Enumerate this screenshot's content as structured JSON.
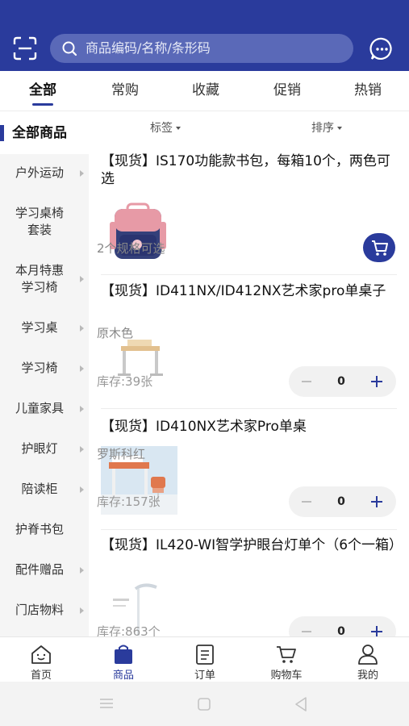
{
  "header": {
    "search_placeholder": "商品编码/名称/条形码",
    "accent_color": "#2a3b9c"
  },
  "tabs": [
    {
      "label": "全部",
      "active": true
    },
    {
      "label": "常购",
      "active": false
    },
    {
      "label": "收藏",
      "active": false
    },
    {
      "label": "促销",
      "active": false
    },
    {
      "label": "热销",
      "active": false
    }
  ],
  "sidebar": {
    "heading": "全部商品",
    "items": [
      {
        "label": "户外运动",
        "has_arrow": true
      },
      {
        "label": "学习桌椅\n套装",
        "has_arrow": false
      },
      {
        "label": "本月特惠\n学习椅",
        "has_arrow": true
      },
      {
        "label": "学习桌",
        "has_arrow": true
      },
      {
        "label": "学习椅",
        "has_arrow": true
      },
      {
        "label": "儿童家具",
        "has_arrow": true
      },
      {
        "label": "护眼灯",
        "has_arrow": true
      },
      {
        "label": "陪读柜",
        "has_arrow": true
      },
      {
        "label": "护脊书包",
        "has_arrow": false
      },
      {
        "label": "配件赠品",
        "has_arrow": true
      },
      {
        "label": "门店物料",
        "has_arrow": true
      }
    ]
  },
  "filters": {
    "tag_label": "标签",
    "sort_label": "排序"
  },
  "products": [
    {
      "title": "【现货】IS170功能款书包，每箱10个，两色可选",
      "subtitle": "2个规格可选",
      "stock": "",
      "quantity": ""
    },
    {
      "title": "【现货】ID411NX/ID412NX艺术家pro单桌子",
      "subtitle": "原木色",
      "stock": "库存:39张",
      "quantity": "0"
    },
    {
      "title": "【现货】ID410NX艺术家Pro单桌",
      "subtitle": "罗斯科红",
      "stock": "库存:157张",
      "quantity": "0"
    },
    {
      "title": "【现货】IL420-WI智学护眼台灯单个（6个一箱）",
      "subtitle": "",
      "stock": "库存:863个",
      "quantity": "0"
    }
  ],
  "bottom_nav": [
    {
      "label": "首页",
      "icon": "home-icon",
      "active": false
    },
    {
      "label": "商品",
      "icon": "shopping-bag-icon",
      "active": true
    },
    {
      "label": "订单",
      "icon": "order-list-icon",
      "active": false
    },
    {
      "label": "购物车",
      "icon": "cart-icon",
      "active": false
    },
    {
      "label": "我的",
      "icon": "person-icon",
      "active": false
    }
  ]
}
